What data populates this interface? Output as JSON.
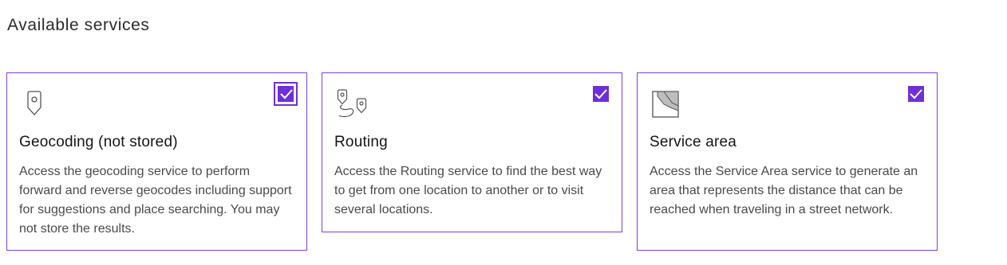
{
  "page": {
    "section_title": "Available services"
  },
  "colors": {
    "accent": "#6f2fd8",
    "border": "#7b3fe4",
    "text": "#151515",
    "muted_text": "#4a4a4a"
  },
  "services": [
    {
      "icon": "location-pin-icon",
      "title": "Geocoding (not stored)",
      "description": "Access the geocoding service to perform forward and reverse geocodes including support for suggestions and place searching. You may not store the results.",
      "checked": true,
      "focused": true
    },
    {
      "icon": "route-icon",
      "title": "Routing",
      "description": "Access the Routing service to find the best way to get from one location to another or to visit several locations.",
      "checked": true,
      "focused": false
    },
    {
      "icon": "service-area-icon",
      "title": "Service area",
      "description": "Access the Service Area service to generate an area that represents the distance that can be reached when traveling in a street network.",
      "checked": true,
      "focused": false
    }
  ]
}
